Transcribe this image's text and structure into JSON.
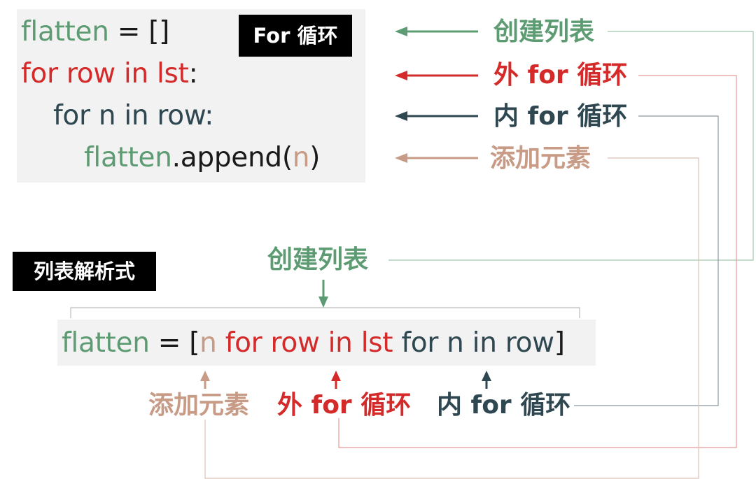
{
  "loop_code": {
    "line1": {
      "var": "flatten",
      "rest": " = []"
    },
    "line2": {
      "kw": "for row in lst",
      "colon": ":"
    },
    "line3": {
      "text": "for n in row:"
    },
    "line4": {
      "var": "flatten",
      "method": ".append(",
      "arg": "n",
      "close": ")"
    }
  },
  "badges": {
    "for_loop": "For 循环",
    "list_comp": "列表解析式"
  },
  "right_labels": {
    "create_list": "创建列表",
    "outer_for": "外 for 循环",
    "inner_for": "内 for 循环",
    "add_element": "添加元素"
  },
  "comprehension": {
    "var": "flatten",
    "eq": " = [",
    "elem": "n",
    "outer": " for row in lst",
    "inner": " for n in row",
    "close": "]"
  },
  "comp_labels": {
    "create_list": "创建列表",
    "add_element": "添加元素",
    "outer_for": "外 for 循环",
    "inner_for": "内 for 循环"
  },
  "colors": {
    "green": "#5d9c72",
    "red": "#d42a2a",
    "dark": "#2e4750",
    "tan": "#c79b85"
  }
}
